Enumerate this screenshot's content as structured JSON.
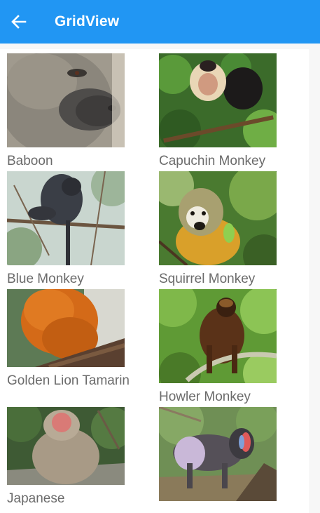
{
  "app_bar": {
    "title": "GridView",
    "back_icon": "arrow-back-icon",
    "color": "#2196f3"
  },
  "grid": {
    "items": [
      {
        "name": "Baboon",
        "image": "baboon-photo"
      },
      {
        "name": "Capuchin Monkey",
        "image": "capuchin-monkey-photo"
      },
      {
        "name": "Blue Monkey",
        "image": "blue-monkey-photo"
      },
      {
        "name": "Squirrel Monkey",
        "image": "squirrel-monkey-photo"
      },
      {
        "name": "Golden Lion Tamarin",
        "image": "golden-lion-tamarin-photo"
      },
      {
        "name": "Howler Monkey",
        "image": "howler-monkey-photo"
      },
      {
        "name": "Japanese",
        "image": "japanese-macaque-photo"
      },
      {
        "name": "",
        "image": "mandrill-photo"
      }
    ]
  }
}
